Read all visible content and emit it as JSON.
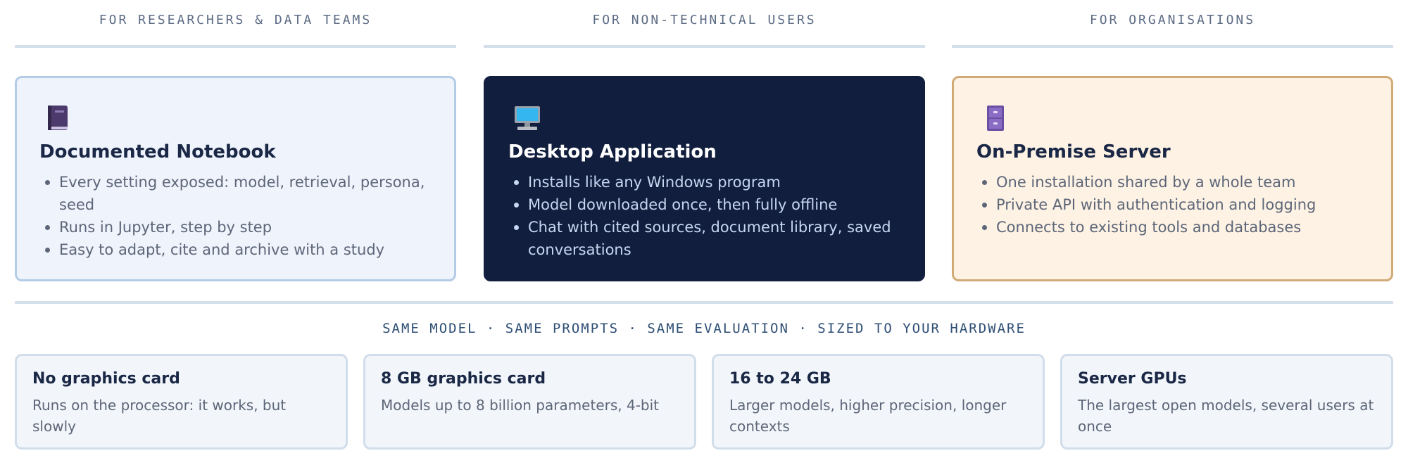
{
  "columns": [
    {
      "heading": "FOR RESEARCHERS & DATA TEAMS"
    },
    {
      "heading": "FOR NON-TECHNICAL USERS"
    },
    {
      "heading": "FOR ORGANISATIONS"
    }
  ],
  "cards": [
    {
      "icon": "book-icon",
      "title": "Documented Notebook",
      "bullets": [
        "Every setting exposed: model, retrieval, persona, seed",
        "Runs in Jupyter, step by step",
        "Easy to adapt, cite and archive with a study"
      ]
    },
    {
      "icon": "desktop-computer-icon",
      "title": "Desktop Application",
      "bullets": [
        "Installs like any Windows program",
        "Model downloaded once, then fully offline",
        "Chat with cited sources, document library, saved conversations"
      ]
    },
    {
      "icon": "file-cabinet-icon",
      "title": "On-Premise Server",
      "bullets": [
        "One installation shared by a whole team",
        "Private API with authentication and logging",
        "Connects to existing tools and databases"
      ]
    }
  ],
  "tagline": "SAME MODEL · SAME PROMPTS · SAME EVALUATION · SIZED TO YOUR HARDWARE",
  "hardware": [
    {
      "title": "No graphics card",
      "desc": "Runs on the processor: it works, but slowly"
    },
    {
      "title": "8 GB graphics card",
      "desc": "Models up to 8 billion parameters, 4-bit"
    },
    {
      "title": "16 to 24 GB",
      "desc": "Larger models, higher precision, longer contexts"
    },
    {
      "title": "Server GPUs",
      "desc": "The largest open models, several users at once"
    }
  ],
  "colors": {
    "dark_card": "#111e3d",
    "light_card": "#eef3fc",
    "warm_card": "#fdf2e4",
    "warm_border": "#d2aa76"
  }
}
